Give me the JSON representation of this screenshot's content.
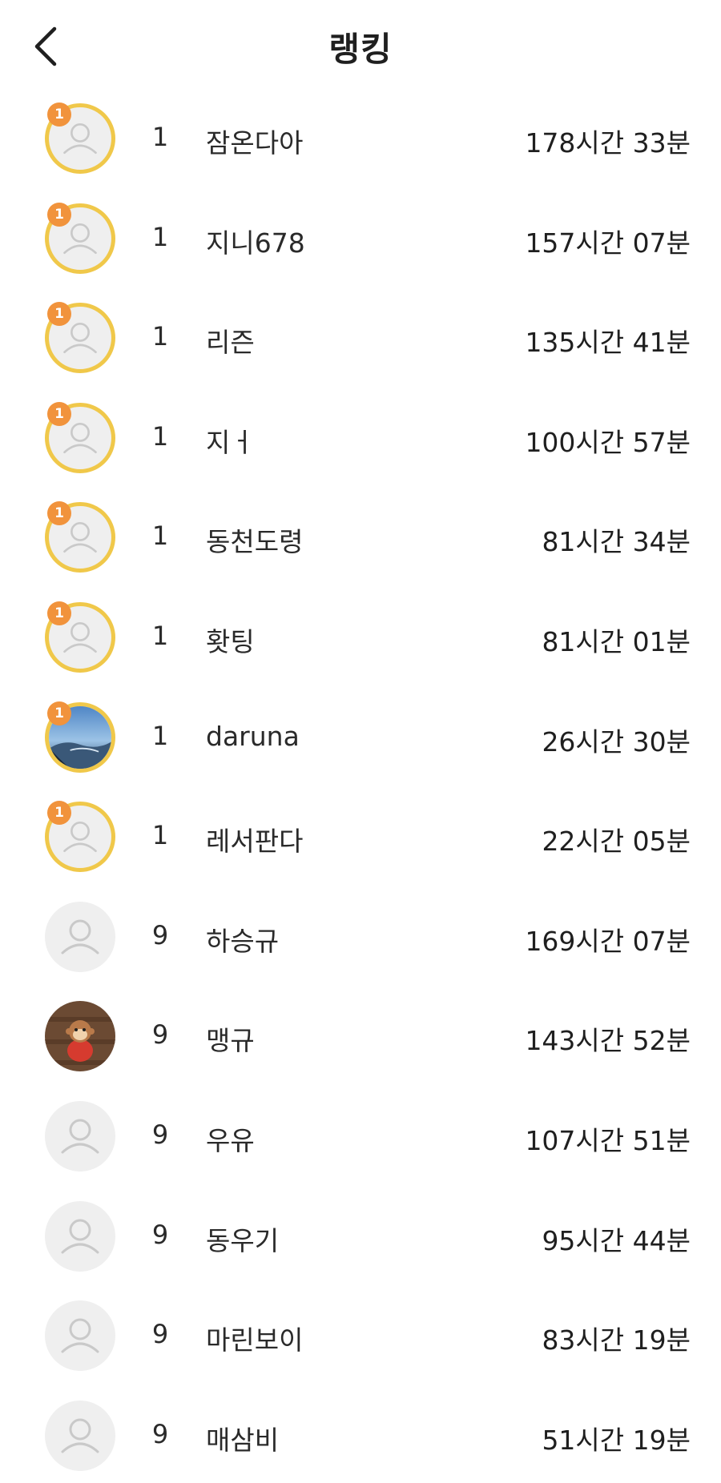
{
  "header": {
    "title": "랭킹",
    "back_icon": "chevron-left-icon"
  },
  "colors": {
    "gold_ring": "#f0c84a",
    "badge": "#f1933c",
    "placeholder_bg": "#efefef"
  },
  "rankings": [
    {
      "rank": "1",
      "name": "잠온다아",
      "time": "178시간 33분",
      "badge": "1",
      "avatar": "default",
      "highlight": true
    },
    {
      "rank": "1",
      "name": "지니678",
      "time": "157시간 07분",
      "badge": "1",
      "avatar": "default",
      "highlight": true
    },
    {
      "rank": "1",
      "name": "리즌",
      "time": "135시간 41분",
      "badge": "1",
      "avatar": "default",
      "highlight": true
    },
    {
      "rank": "1",
      "name": "지ㅓ",
      "time": "100시간 57분",
      "badge": "1",
      "avatar": "default",
      "highlight": true
    },
    {
      "rank": "1",
      "name": "동천도령",
      "time": "81시간 34분",
      "badge": "1",
      "avatar": "default",
      "highlight": true
    },
    {
      "rank": "1",
      "name": "홧팅",
      "time": "81시간 01분",
      "badge": "1",
      "avatar": "default",
      "highlight": true
    },
    {
      "rank": "1",
      "name": "daruna",
      "time": "26시간 30분",
      "badge": "1",
      "avatar": "landscape-photo",
      "highlight": true
    },
    {
      "rank": "1",
      "name": "레서판다",
      "time": "22시간 05분",
      "badge": "1",
      "avatar": "default",
      "highlight": true
    },
    {
      "rank": "9",
      "name": "하승규",
      "time": "169시간 07분",
      "avatar": "default",
      "highlight": false
    },
    {
      "rank": "9",
      "name": "맹규",
      "time": "143시간 52분",
      "avatar": "monkey-photo",
      "highlight": false
    },
    {
      "rank": "9",
      "name": "우유",
      "time": "107시간 51분",
      "avatar": "default",
      "highlight": false
    },
    {
      "rank": "9",
      "name": "동우기",
      "time": "95시간 44분",
      "avatar": "default",
      "highlight": false
    },
    {
      "rank": "9",
      "name": "마린보이",
      "time": "83시간 19분",
      "avatar": "default",
      "highlight": false
    },
    {
      "rank": "9",
      "name": "매삼비",
      "time": "51시간 19분",
      "avatar": "default",
      "highlight": false
    }
  ]
}
